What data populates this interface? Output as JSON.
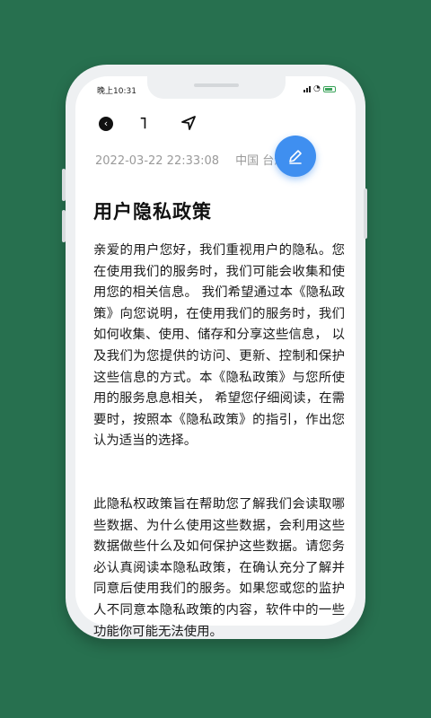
{
  "status_bar": {
    "time": "晚上10:31"
  },
  "toolbar": {
    "back_icon": "back-arrow-icon",
    "undo_icon": "undo-icon",
    "navigate_icon": "navigation-arrow-icon",
    "undo_glyph": "˥"
  },
  "note": {
    "datetime": "2022-03-22 22:33:08",
    "location": "中国 台湾",
    "title": "用户隐私政策",
    "paragraphs": [
      "亲爱的用户您好，我们重视用户的隐私。您在使用我们的服务时，我们可能会收集和使用您的相关信息。 我们希望通过本《隐私政策》向您说明，在使用我们的服务时，我们如何收集、使用、储存和分享这些信息， 以及我们为您提供的访问、更新、控制和保护这些信息的方式。本《隐私政策》与您所使用的服务息息相关， 希望您仔细阅读，在需要时，按照本《隐私政策》的指引，作出您认为适当的选择。",
      "此隐私权政策旨在帮助您了解我们会读取哪些数据、为什么使用这些数据，会利用这些数据做些什么及如何保护这些数据。请您务必认真阅读本隐私政策，在确认充分了解并同意后使用我们的服务。如果您或您的监护人不同意本隐私政策的内容，软件中的一些功能你可能无法使用。"
    ]
  },
  "fab": {
    "icon": "edit-pencil-icon"
  },
  "colors": {
    "background": "#27704f",
    "accent": "#3f8ff0",
    "meta_text": "#9a9a9a"
  }
}
